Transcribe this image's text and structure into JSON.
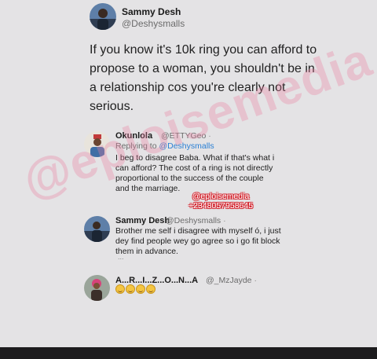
{
  "watermark": {
    "text": "@eploisemedia"
  },
  "main_tweet": {
    "name": "Sammy Desh",
    "handle": "@Deshysmalls",
    "text": "If you know it's 10k ring you can afford to propose to a woman, you shouldn't be in a relationship cos you're clearly not serious."
  },
  "reply1": {
    "name": "Okunlola",
    "handle": "@ETTYGeo",
    "sep": "·",
    "replying_prefix": "Replying to ",
    "replying_handle": "@Deshysmalls",
    "text": "I beg to disagree Baba. What if that's what i can afford? The cost of a ring is not directly proportional to the success of the couple and the marriage."
  },
  "stamp": {
    "line1": "@eploisemedia",
    "line2": "+2348057958645"
  },
  "reply2": {
    "name": "Sammy Desh",
    "handle": "@Deshysmalls",
    "sep": "·",
    "text": "Brother me self i disagree with myself ó, i just dey find people wey go agree so i go fit block them in advance.",
    "more": "..."
  },
  "reply3": {
    "name": "A...R...I...Z...O...N...A",
    "handle": "@_MzJayde",
    "sep": "·",
    "emoji_count": 4,
    "emoji": "grinning-sweat-face-icon"
  },
  "colors": {
    "link": "#2a7fd4",
    "watermark": "#e980a0",
    "stamp_outline": "#d3202a",
    "bottom_bar": "#1d1c1e"
  }
}
